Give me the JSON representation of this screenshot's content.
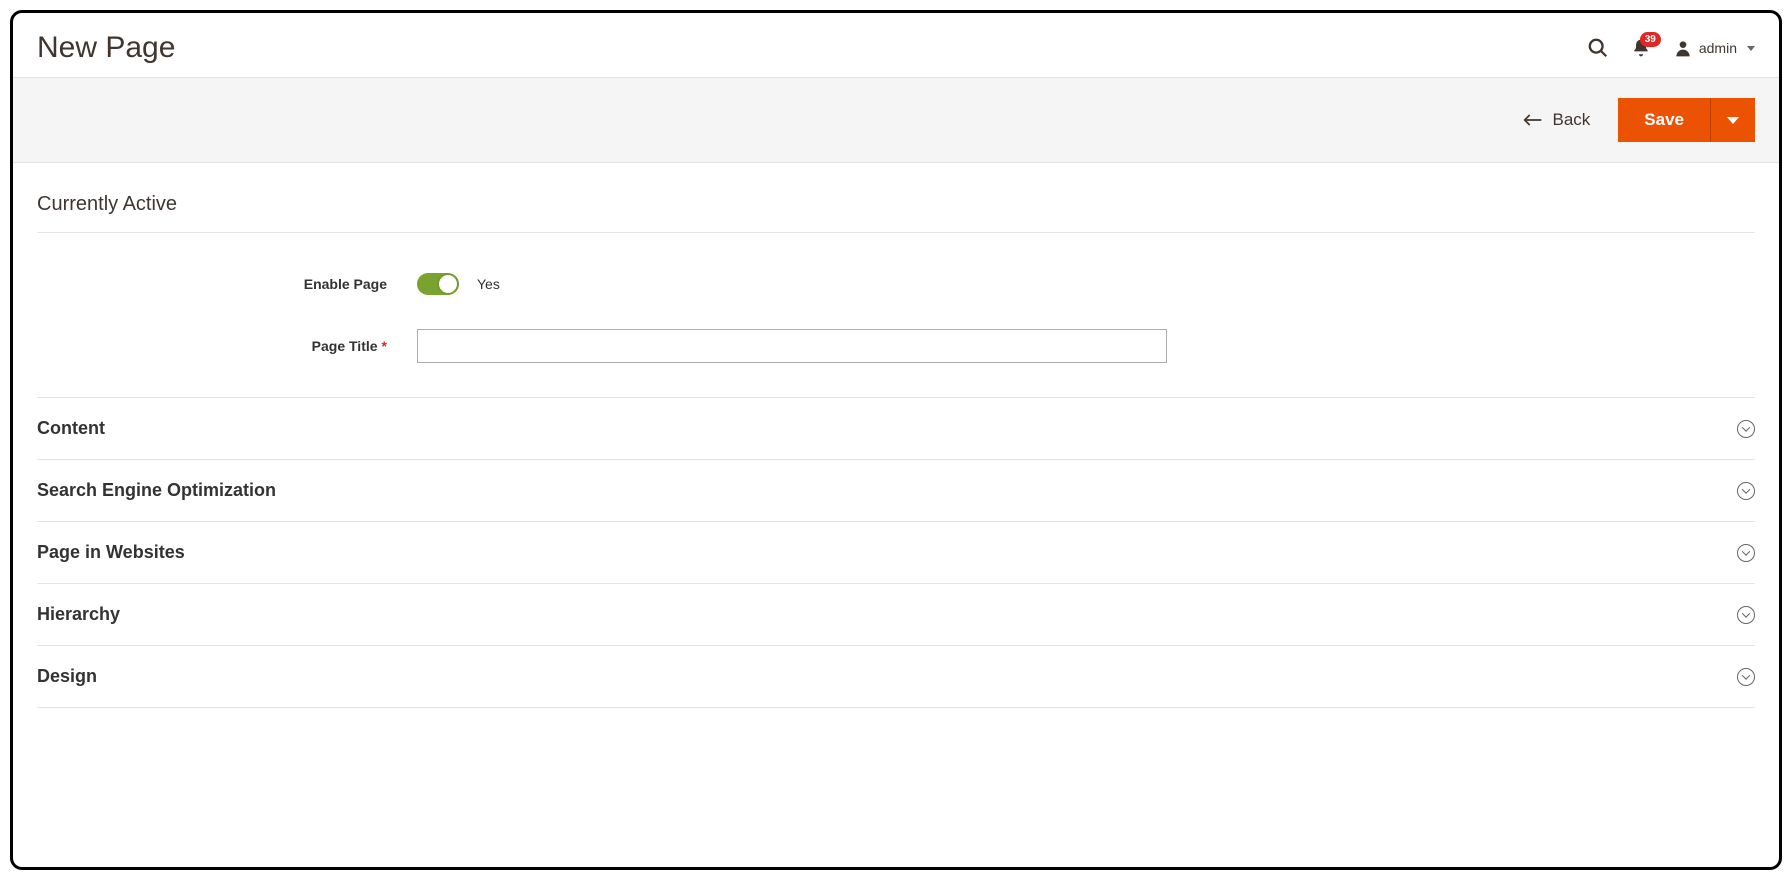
{
  "header": {
    "title": "New Page",
    "notifications_count": "39",
    "user_label": "admin"
  },
  "actions": {
    "back_label": "Back",
    "save_label": "Save"
  },
  "section": {
    "heading": "Currently Active"
  },
  "form": {
    "enable_page_label": "Enable Page",
    "enable_page_value": "Yes",
    "page_title_label": "Page Title",
    "page_title_value": ""
  },
  "fieldsets": [
    {
      "label": "Content"
    },
    {
      "label": "Search Engine Optimization"
    },
    {
      "label": "Page in Websites"
    },
    {
      "label": "Hierarchy"
    },
    {
      "label": "Design"
    }
  ]
}
